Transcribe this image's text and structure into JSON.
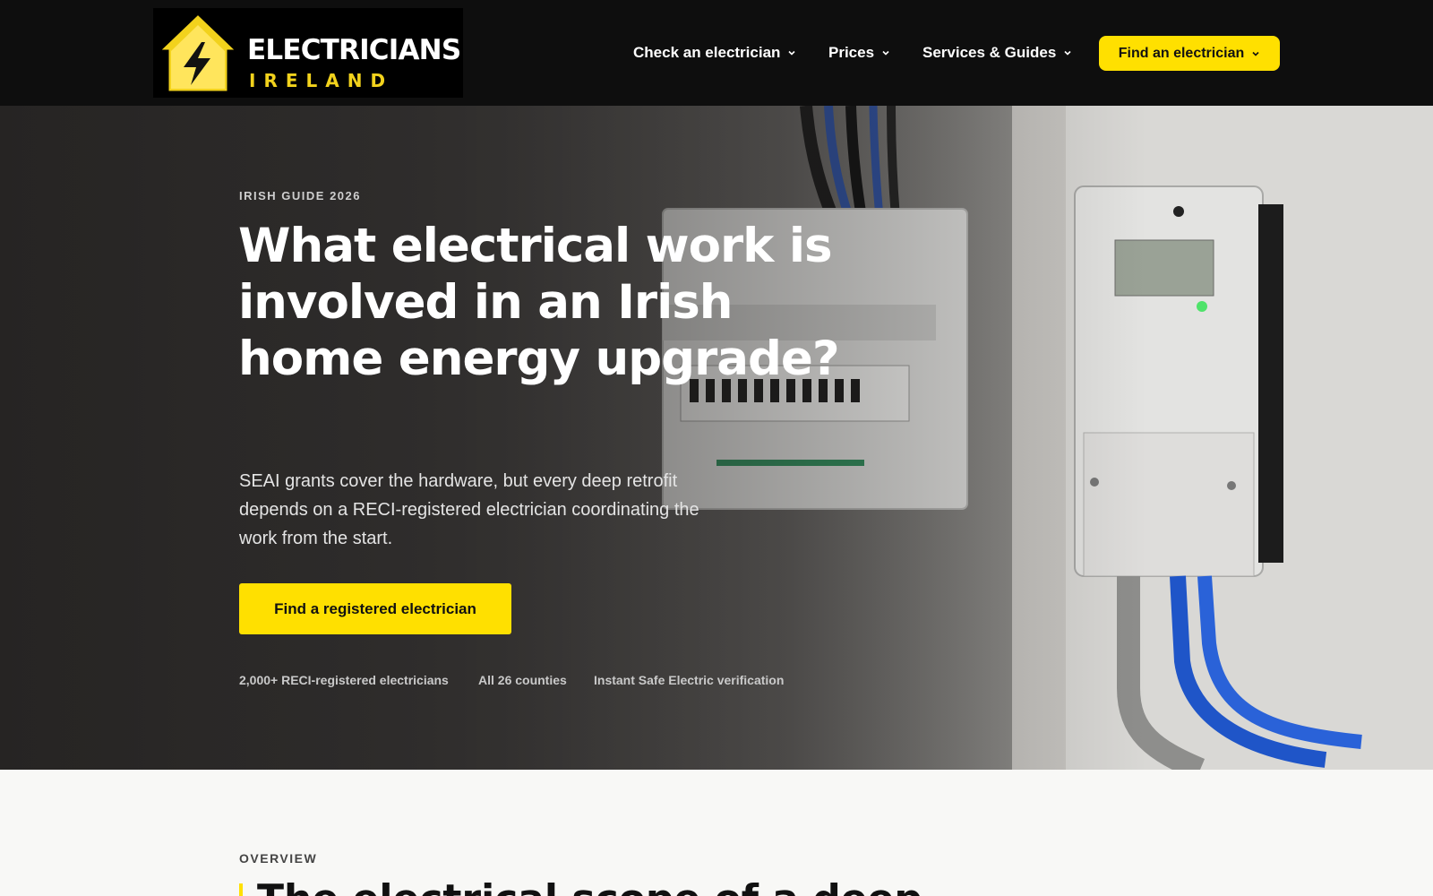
{
  "header": {
    "logo": {
      "line1": "ELECTRICIANS",
      "line2": "IRELAND"
    },
    "nav": [
      {
        "label": "Check an electrician"
      },
      {
        "label": "Prices"
      },
      {
        "label": "Services & Guides"
      }
    ],
    "cta_label": "Find an electrician"
  },
  "hero": {
    "eyebrow": "IRISH GUIDE 2026",
    "title": "What electrical work is involved in an Irish home energy upgrade?",
    "subtitle": "SEAI grants cover the hardware, but every deep retrofit depends on a RECI-registered electrician coordinating the work from the start.",
    "cta_label": "Find a registered electrician",
    "stats": [
      "2,000+ RECI-registered electricians",
      "All 26 counties",
      "Instant Safe Electric verification"
    ]
  },
  "overview": {
    "label": "OVERVIEW",
    "title": "The electrical scope of a deep"
  },
  "colors": {
    "accent": "#ffe000",
    "header_bg": "#0e0e0e",
    "logo_yellow": "#f2d21c"
  },
  "icons": [
    "house-bolt-logo",
    "chevron-down-icon"
  ]
}
